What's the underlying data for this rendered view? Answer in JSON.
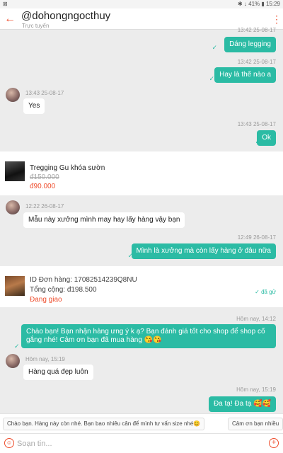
{
  "statusbar": {
    "left": "⊠",
    "right": "✱ ↓ 41% ▮ 15:29"
  },
  "header": {
    "title": "@dohongngocthuy",
    "subtitle": "Trực tuyến"
  },
  "messages": [
    {
      "time": "13:42 25-08-17",
      "text": "Dáng legging"
    },
    {
      "time": "13:42 25-08-17",
      "text": "Hay là thế nào a"
    },
    {
      "time": "13:43 25-08-17",
      "text": "Yes"
    },
    {
      "time": "13:43 25-08-17",
      "text": "Ok"
    },
    {
      "time": "12:22 26-08-17",
      "text": "Mẫu này xưởng mình may hay lấy hàng vậy bạn"
    },
    {
      "time": "12:49 26-08-17",
      "text": "Mình là xưởng mà còn lấy hàng ở đâu nữa"
    },
    {
      "time": "Hôm nay, 14:12",
      "text": "Chào bạn! Bạn nhận hàng ưng ý k ạ? Bạn đánh giá tốt cho shop để shop cố gắng nhé! Cảm ơn bạn đã mua hàng 😘😘"
    },
    {
      "time": "Hôm nay, 15:19",
      "text": "Hàng quá đẹp luôn"
    },
    {
      "time": "Hôm nay, 15:19",
      "text": "Đa tạ! Đa tạ 🥰🥰"
    }
  ],
  "product": {
    "name": "Tregging Gu khóa sườn",
    "old_price": "đ150.000",
    "price": "đ90.000"
  },
  "order": {
    "id_line": "ID Đơn hàng: 17082514239Q8NU",
    "total_line": "Tổng cộng: đ198.500",
    "status": "Đang giao",
    "delivered": "✓ đã gử"
  },
  "quick_replies": [
    "Chào bạn. Hàng này còn nhé. Bạn bao nhiêu cân để mình tư vấn size nhé😊",
    "Cảm ơn bạn nhiều"
  ],
  "input": {
    "placeholder": "Soạn tin..."
  },
  "tick": "✓",
  "icons": {
    "back": "←",
    "more": "⋮",
    "emoji": "☺",
    "plus": "+"
  },
  "colors": {
    "accent": "#ee4d2d",
    "outgoing": "#2bbba4"
  }
}
